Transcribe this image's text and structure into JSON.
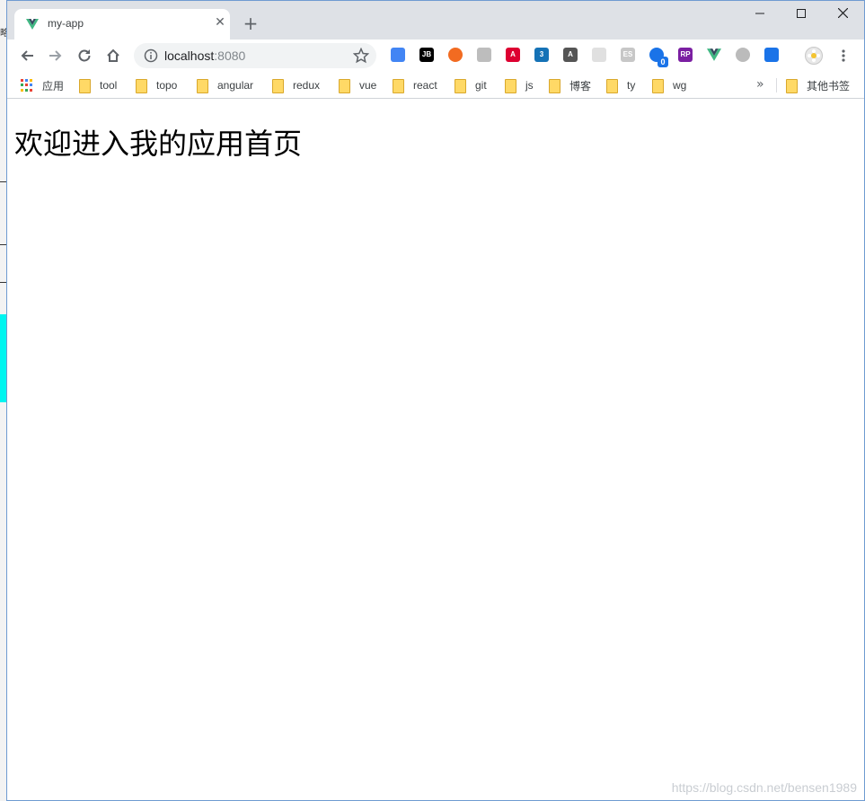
{
  "browser": {
    "tab": {
      "title": "my-app",
      "favicon": "vue-logo-icon"
    },
    "window_controls": {
      "minimize": "–",
      "maximize": "☐",
      "close": "✕"
    }
  },
  "toolbar": {
    "url_host": "localhost",
    "url_port": ":8080",
    "extensions": [
      {
        "name": "google-translate-icon",
        "label": "",
        "color": "#4285f4"
      },
      {
        "name": "jetbrains-icon",
        "label": "JB",
        "color": "#000000"
      },
      {
        "name": "orange-extension-icon",
        "label": "",
        "color": "#f26b21"
      },
      {
        "name": "shield-extension-icon",
        "label": "",
        "color": "#bdbdbd"
      },
      {
        "name": "angular-icon",
        "label": "A",
        "color": "#dd0031"
      },
      {
        "name": "css3-icon",
        "label": "3",
        "color": "#1572b6"
      },
      {
        "name": "font-a-icon",
        "label": "A",
        "color": "#555555"
      },
      {
        "name": "react-devtools-icon",
        "label": "",
        "color": "#e0e0e0"
      },
      {
        "name": "es-icon",
        "label": "ES",
        "color": "#c7c7c7"
      },
      {
        "name": "badge-extension-icon",
        "label": "",
        "color": "#1a73e8"
      },
      {
        "name": "rp-icon",
        "label": "RP",
        "color": "#7b1fa2"
      },
      {
        "name": "vue-devtools-icon",
        "label": "",
        "color": "#41b883"
      },
      {
        "name": "target-extension-icon",
        "label": "",
        "color": "#bbbbbb"
      },
      {
        "name": "download-extension-icon",
        "label": "",
        "color": "#1a73e8"
      }
    ],
    "badge_count": "0"
  },
  "bookmarks": {
    "apps_label": "应用",
    "items": [
      "tool",
      "topo",
      "angular",
      "redux",
      "vue",
      "react",
      "git",
      "js",
      "博客",
      "ty",
      "wg"
    ],
    "other_label": "其他书签"
  },
  "page": {
    "heading": "欢迎进入我的应用首页",
    "watermark": "https://blog.csdn.net/bensen1989"
  }
}
